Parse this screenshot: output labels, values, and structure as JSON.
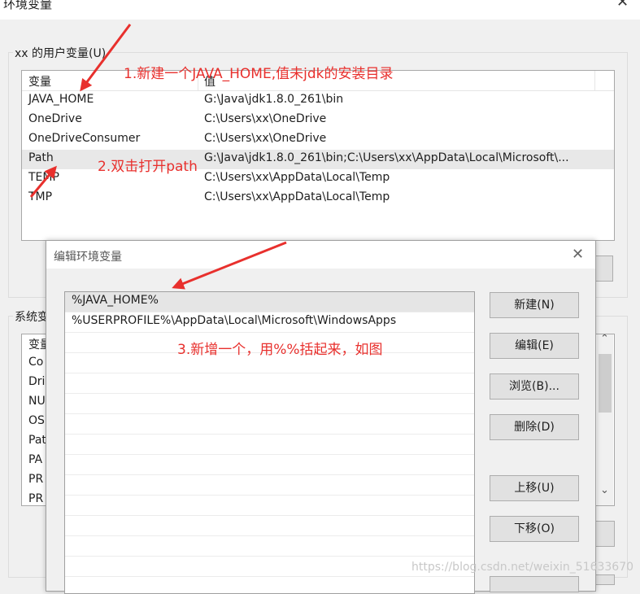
{
  "outer_window": {
    "title": "环境变量",
    "close_glyph": "✕",
    "user_group_label": "xx 的用户变量(U)",
    "system_group_label_partial": "系统变",
    "user_vars": {
      "columns": [
        "变量",
        "值"
      ],
      "rows": [
        {
          "name": "JAVA_HOME",
          "value": "G:\\Java\\jdk1.8.0_261\\bin"
        },
        {
          "name": "OneDrive",
          "value": "C:\\Users\\xx\\OneDrive"
        },
        {
          "name": "OneDriveConsumer",
          "value": "C:\\Users\\xx\\OneDrive"
        },
        {
          "name": "Path",
          "value": "G:\\Java\\jdk1.8.0_261\\bin;C:\\Users\\xx\\AppData\\Local\\Microsoft\\..."
        },
        {
          "name": "TEMP",
          "value": "C:\\Users\\xx\\AppData\\Local\\Temp"
        },
        {
          "name": "TMP",
          "value": "C:\\Users\\xx\\AppData\\Local\\Temp"
        }
      ]
    },
    "system_vars_partial": {
      "header": "变量",
      "rows": [
        "Co",
        "Dri",
        "NU",
        "OS",
        "Pat",
        "PA",
        "PR",
        "PR"
      ]
    },
    "scroll_down_glyph": "⌄",
    "scroll_up_glyph": "⌃"
  },
  "dialog": {
    "title": "编辑环境变量",
    "close_glyph": "✕",
    "entries": [
      "%JAVA_HOME%",
      "%USERPROFILE%\\AppData\\Local\\Microsoft\\WindowsApps"
    ],
    "buttons": {
      "new": "新建(N)",
      "edit": "编辑(E)",
      "browse": "浏览(B)...",
      "delete": "删除(D)",
      "move_up": "上移(U)",
      "move_down": "下移(O)"
    }
  },
  "annotations": {
    "step1": "1.新建一个JAVA_HOME,值未jdk的安装目录",
    "step2": "2.双击打开path",
    "step3": "3.新增一个，用%%括起来，如图",
    "color": "#e8302d"
  },
  "watermark": "https://blog.csdn.net/weixin_51633670"
}
